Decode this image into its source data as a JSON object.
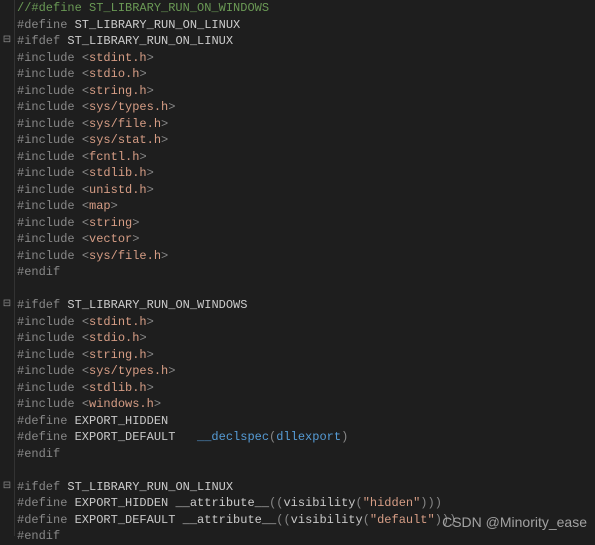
{
  "lines": [
    {
      "fold": "",
      "parts": [
        {
          "cls": "comment",
          "t": "//#define ST_LIBRARY_RUN_ON_WINDOWS"
        }
      ]
    },
    {
      "fold": "",
      "parts": [
        {
          "cls": "keyword",
          "t": "#define "
        },
        {
          "cls": "macro",
          "t": "ST_LIBRARY_RUN_ON_LINUX"
        }
      ]
    },
    {
      "fold": "⊟",
      "parts": [
        {
          "cls": "keyword",
          "t": "#ifdef "
        },
        {
          "cls": "macro",
          "t": "ST_LIBRARY_RUN_ON_LINUX"
        }
      ]
    },
    {
      "fold": "",
      "parts": [
        {
          "cls": "keyword",
          "t": "#include "
        },
        {
          "cls": "angle",
          "t": "<"
        },
        {
          "cls": "include-file",
          "t": "stdint.h"
        },
        {
          "cls": "angle",
          "t": ">"
        }
      ]
    },
    {
      "fold": "",
      "parts": [
        {
          "cls": "keyword",
          "t": "#include "
        },
        {
          "cls": "angle",
          "t": "<"
        },
        {
          "cls": "include-file",
          "t": "stdio.h"
        },
        {
          "cls": "angle",
          "t": ">"
        }
      ]
    },
    {
      "fold": "",
      "parts": [
        {
          "cls": "keyword",
          "t": "#include "
        },
        {
          "cls": "angle",
          "t": "<"
        },
        {
          "cls": "include-file",
          "t": "string.h"
        },
        {
          "cls": "angle",
          "t": ">"
        }
      ]
    },
    {
      "fold": "",
      "parts": [
        {
          "cls": "keyword",
          "t": "#include "
        },
        {
          "cls": "angle",
          "t": "<"
        },
        {
          "cls": "include-file",
          "t": "sys/types.h"
        },
        {
          "cls": "angle",
          "t": ">"
        }
      ]
    },
    {
      "fold": "",
      "parts": [
        {
          "cls": "keyword",
          "t": "#include "
        },
        {
          "cls": "angle",
          "t": "<"
        },
        {
          "cls": "include-file",
          "t": "sys/file.h"
        },
        {
          "cls": "angle",
          "t": ">"
        }
      ]
    },
    {
      "fold": "",
      "parts": [
        {
          "cls": "keyword",
          "t": "#include "
        },
        {
          "cls": "angle",
          "t": "<"
        },
        {
          "cls": "include-file",
          "t": "sys/stat.h"
        },
        {
          "cls": "angle",
          "t": ">"
        }
      ]
    },
    {
      "fold": "",
      "parts": [
        {
          "cls": "keyword",
          "t": "#include "
        },
        {
          "cls": "angle",
          "t": "<"
        },
        {
          "cls": "include-file",
          "t": "fcntl.h"
        },
        {
          "cls": "angle",
          "t": ">"
        }
      ]
    },
    {
      "fold": "",
      "parts": [
        {
          "cls": "keyword",
          "t": "#include "
        },
        {
          "cls": "angle",
          "t": "<"
        },
        {
          "cls": "include-file",
          "t": "stdlib.h"
        },
        {
          "cls": "angle",
          "t": ">"
        }
      ]
    },
    {
      "fold": "",
      "parts": [
        {
          "cls": "keyword",
          "t": "#include "
        },
        {
          "cls": "angle",
          "t": "<"
        },
        {
          "cls": "include-file",
          "t": "unistd.h"
        },
        {
          "cls": "angle",
          "t": ">"
        }
      ]
    },
    {
      "fold": "",
      "parts": [
        {
          "cls": "keyword",
          "t": "#include "
        },
        {
          "cls": "angle",
          "t": "<"
        },
        {
          "cls": "include-file",
          "t": "map"
        },
        {
          "cls": "angle",
          "t": ">"
        }
      ]
    },
    {
      "fold": "",
      "parts": [
        {
          "cls": "keyword",
          "t": "#include "
        },
        {
          "cls": "angle",
          "t": "<"
        },
        {
          "cls": "include-file",
          "t": "string"
        },
        {
          "cls": "angle",
          "t": ">"
        }
      ]
    },
    {
      "fold": "",
      "parts": [
        {
          "cls": "keyword",
          "t": "#include "
        },
        {
          "cls": "angle",
          "t": "<"
        },
        {
          "cls": "include-file",
          "t": "vector"
        },
        {
          "cls": "angle",
          "t": ">"
        }
      ]
    },
    {
      "fold": "",
      "parts": [
        {
          "cls": "keyword",
          "t": "#include "
        },
        {
          "cls": "angle",
          "t": "<"
        },
        {
          "cls": "include-file",
          "t": "sys/file.h"
        },
        {
          "cls": "angle",
          "t": ">"
        }
      ]
    },
    {
      "fold": "",
      "parts": [
        {
          "cls": "keyword",
          "t": "#endif"
        }
      ]
    },
    {
      "fold": "",
      "parts": [
        {
          "cls": "",
          "t": ""
        }
      ]
    },
    {
      "fold": "⊟",
      "parts": [
        {
          "cls": "keyword",
          "t": "#ifdef "
        },
        {
          "cls": "macro",
          "t": "ST_LIBRARY_RUN_ON_WINDOWS"
        }
      ]
    },
    {
      "fold": "",
      "parts": [
        {
          "cls": "keyword",
          "t": "#include "
        },
        {
          "cls": "angle",
          "t": "<"
        },
        {
          "cls": "include-file",
          "t": "stdint.h"
        },
        {
          "cls": "angle",
          "t": ">"
        }
      ]
    },
    {
      "fold": "",
      "parts": [
        {
          "cls": "keyword",
          "t": "#include "
        },
        {
          "cls": "angle",
          "t": "<"
        },
        {
          "cls": "include-file",
          "t": "stdio.h"
        },
        {
          "cls": "angle",
          "t": ">"
        }
      ]
    },
    {
      "fold": "",
      "parts": [
        {
          "cls": "keyword",
          "t": "#include "
        },
        {
          "cls": "angle",
          "t": "<"
        },
        {
          "cls": "include-file",
          "t": "string.h"
        },
        {
          "cls": "angle",
          "t": ">"
        }
      ]
    },
    {
      "fold": "",
      "parts": [
        {
          "cls": "keyword",
          "t": "#include "
        },
        {
          "cls": "angle",
          "t": "<"
        },
        {
          "cls": "include-file",
          "t": "sys/types.h"
        },
        {
          "cls": "angle",
          "t": ">"
        }
      ]
    },
    {
      "fold": "",
      "parts": [
        {
          "cls": "keyword",
          "t": "#include "
        },
        {
          "cls": "angle",
          "t": "<"
        },
        {
          "cls": "include-file",
          "t": "stdlib.h"
        },
        {
          "cls": "angle",
          "t": ">"
        }
      ]
    },
    {
      "fold": "",
      "parts": [
        {
          "cls": "keyword",
          "t": "#include "
        },
        {
          "cls": "angle",
          "t": "<"
        },
        {
          "cls": "include-file",
          "t": "windows.h"
        },
        {
          "cls": "angle",
          "t": ">"
        }
      ]
    },
    {
      "fold": "",
      "parts": [
        {
          "cls": "keyword",
          "t": "#define "
        },
        {
          "cls": "ident",
          "t": "EXPORT_HIDDEN"
        }
      ]
    },
    {
      "fold": "",
      "parts": [
        {
          "cls": "keyword",
          "t": "#define "
        },
        {
          "cls": "ident",
          "t": "EXPORT_DEFAULT   "
        },
        {
          "cls": "func",
          "t": "__declspec"
        },
        {
          "cls": "paren",
          "t": "("
        },
        {
          "cls": "func",
          "t": "dllexport"
        },
        {
          "cls": "paren",
          "t": ")"
        }
      ]
    },
    {
      "fold": "",
      "parts": [
        {
          "cls": "keyword",
          "t": "#endif"
        }
      ]
    },
    {
      "fold": "",
      "parts": [
        {
          "cls": "",
          "t": ""
        }
      ]
    },
    {
      "fold": "⊟",
      "parts": [
        {
          "cls": "keyword",
          "t": "#ifdef "
        },
        {
          "cls": "macro",
          "t": "ST_LIBRARY_RUN_ON_LINUX"
        }
      ]
    },
    {
      "fold": "",
      "parts": [
        {
          "cls": "keyword",
          "t": "#define "
        },
        {
          "cls": "ident",
          "t": "EXPORT_HIDDEN "
        },
        {
          "cls": "attr",
          "t": "__attribute__"
        },
        {
          "cls": "paren",
          "t": "(("
        },
        {
          "cls": "ident",
          "t": "visibility"
        },
        {
          "cls": "paren",
          "t": "("
        },
        {
          "cls": "string",
          "t": "\"hidden\""
        },
        {
          "cls": "paren",
          "t": ")))"
        }
      ]
    },
    {
      "fold": "",
      "parts": [
        {
          "cls": "keyword",
          "t": "#define "
        },
        {
          "cls": "ident",
          "t": "EXPORT_DEFAULT "
        },
        {
          "cls": "attr",
          "t": "__attribute__"
        },
        {
          "cls": "paren",
          "t": "(("
        },
        {
          "cls": "ident",
          "t": "visibility"
        },
        {
          "cls": "paren",
          "t": "("
        },
        {
          "cls": "string",
          "t": "\"default\""
        },
        {
          "cls": "paren",
          "t": ")))"
        }
      ]
    },
    {
      "fold": "",
      "parts": [
        {
          "cls": "keyword",
          "t": "#endif"
        }
      ]
    }
  ],
  "watermark": "CSDN @Minority_ease"
}
